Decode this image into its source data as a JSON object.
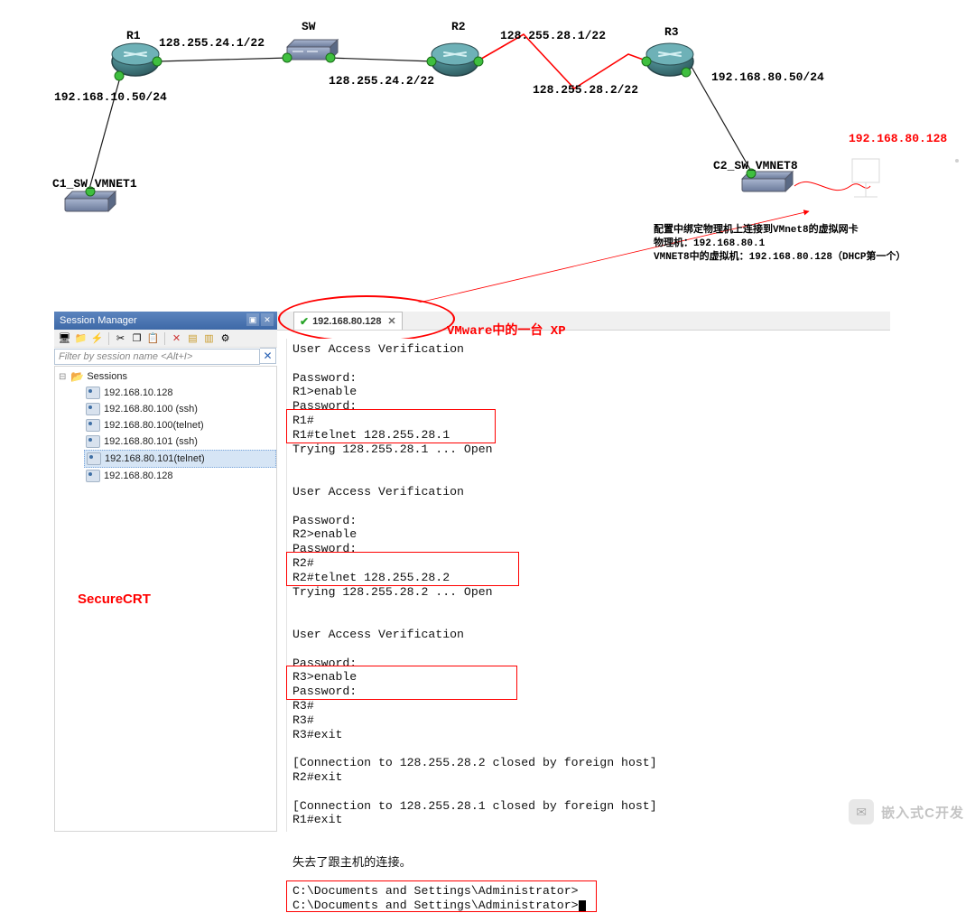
{
  "topology": {
    "nodes": {
      "r1": {
        "label": "R1"
      },
      "sw": {
        "label": "SW"
      },
      "r2": {
        "label": "R2"
      },
      "r3": {
        "label": "R3"
      },
      "c1": {
        "label": "C1_SW_VMNET1"
      },
      "c2": {
        "label": "C2_SW_VMNET8"
      },
      "pc_ip": "192.168.80.128"
    },
    "ips": {
      "r1_sw": "128.255.24.1/22",
      "sw_r2": "128.255.24.2/22",
      "r2_r3_left": "128.255.28.1/22",
      "r2_r3_right": "128.255.28.2/22",
      "r3_lan": "192.168.80.50/24",
      "r1_lan": "192.168.10.50/24"
    },
    "annotation": {
      "line1": "配置中绑定物理机上连接到VMnet8的虚拟网卡",
      "line2": "物理机：192.168.80.1",
      "line3": "VMNET8中的虚拟机：192.168.80.128（DHCP第一个）"
    }
  },
  "crt": {
    "title": "Session Manager",
    "filter_placeholder": "Filter by session name <Alt+I>",
    "tab_ip": "192.168.80.128",
    "vmware_note": "VMware中的一台 XP",
    "securecrt_note": "SecureCRT",
    "tree_root": "Sessions",
    "tree_items": [
      "192.168.10.128",
      "192.168.80.100 (ssh)",
      "192.168.80.100(telnet)",
      "192.168.80.101 (ssh)",
      "192.168.80.101(telnet)",
      "192.168.80.128"
    ],
    "selected_index": 4,
    "terminal_lines": [
      "User Access Verification",
      "",
      "Password:",
      "R1>enable",
      "Password:",
      "R1#",
      "R1#telnet 128.255.28.1",
      "Trying 128.255.28.1 ... Open",
      "",
      "",
      "User Access Verification",
      "",
      "Password:",
      "R2>enable",
      "Password:",
      "R2#",
      "R2#telnet 128.255.28.2",
      "Trying 128.255.28.2 ... Open",
      "",
      "",
      "User Access Verification",
      "",
      "Password:",
      "R3>enable",
      "Password:",
      "R3#",
      "R3#",
      "R3#exit",
      "",
      "[Connection to 128.255.28.2 closed by foreign host]",
      "R2#exit",
      "",
      "[Connection to 128.255.28.1 closed by foreign host]",
      "R1#exit",
      "",
      "",
      "失去了跟主机的连接。",
      "",
      "C:\\Documents and Settings\\Administrator>",
      "C:\\Documents and Settings\\Administrator>"
    ]
  },
  "watermark": "嵌入式C开发"
}
